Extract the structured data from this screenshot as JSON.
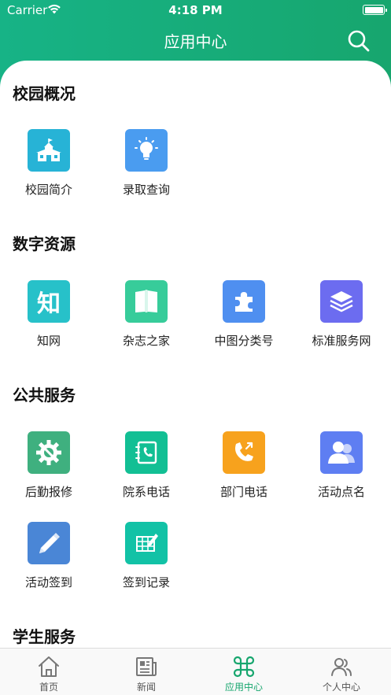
{
  "status_bar": {
    "carrier": "Carrier",
    "time": "4:18 PM"
  },
  "nav": {
    "title": "应用中心"
  },
  "colors": {
    "brand": "#17a66e",
    "header_gradient_start": "#17b386"
  },
  "sections": [
    {
      "title": "校园概况",
      "apps": [
        {
          "label": "校园简介",
          "icon": "school-icon",
          "color": "#27b3d6"
        },
        {
          "label": "录取查询",
          "icon": "lightbulb-icon",
          "color": "#4a9cf0"
        }
      ]
    },
    {
      "title": "数字资源",
      "apps": [
        {
          "label": "知网",
          "icon": "zhi-glyph-icon",
          "glyph": "知",
          "color": "#27c1c9"
        },
        {
          "label": "杂志之家",
          "icon": "book-icon",
          "color": "#37cc9a"
        },
        {
          "label": "中图分类号",
          "icon": "puzzle-icon",
          "color": "#4f8ff0"
        },
        {
          "label": "标准服务网",
          "icon": "layers-icon",
          "color": "#6c6cf0"
        }
      ]
    },
    {
      "title": "公共服务",
      "apps": [
        {
          "label": "后勤报修",
          "icon": "gear-wrench-icon",
          "color": "#3fb07f"
        },
        {
          "label": "院系电话",
          "icon": "phonebook-icon",
          "color": "#12bf94"
        },
        {
          "label": "部门电话",
          "icon": "phone-icon",
          "color": "#f7a21d"
        },
        {
          "label": "活动点名",
          "icon": "users-icon",
          "color": "#5e7ef2"
        },
        {
          "label": "活动签到",
          "icon": "pencil-icon",
          "color": "#4a86d6"
        },
        {
          "label": "签到记录",
          "icon": "spreadsheet-edit-icon",
          "color": "#12c2a6"
        }
      ]
    },
    {
      "title": "学生服务",
      "apps": []
    }
  ],
  "tabbar": {
    "items": [
      {
        "label": "首页",
        "icon": "home-icon",
        "active": false
      },
      {
        "label": "新闻",
        "icon": "newspaper-icon",
        "active": false
      },
      {
        "label": "应用中心",
        "icon": "command-icon",
        "active": true
      },
      {
        "label": "个人中心",
        "icon": "user-group-icon",
        "active": false
      }
    ]
  }
}
